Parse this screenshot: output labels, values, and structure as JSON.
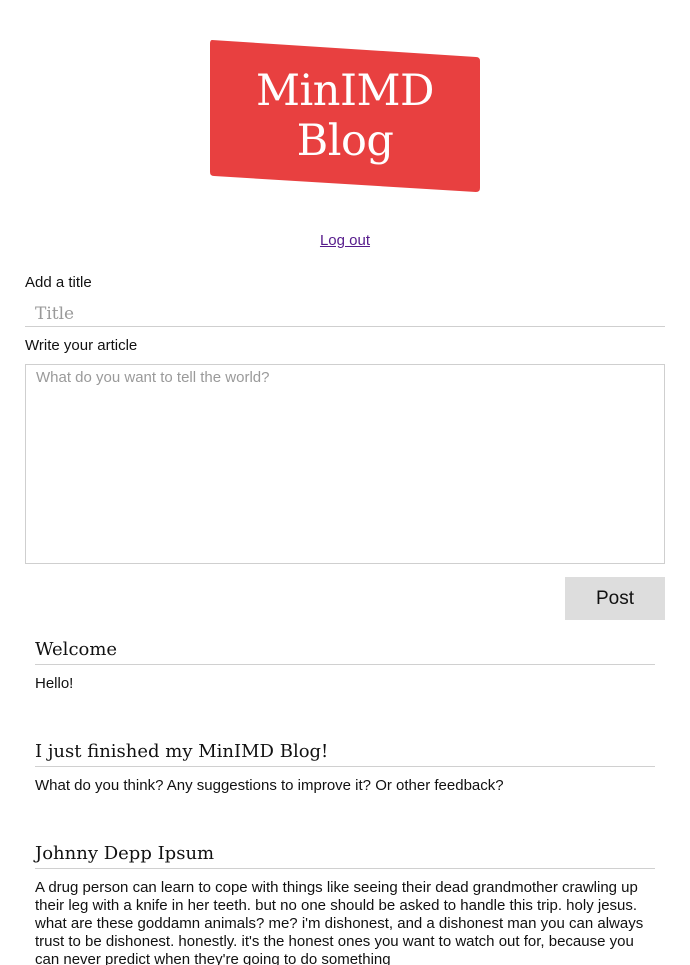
{
  "header": {
    "logo_line1": "MinIMD",
    "logo_line2": "Blog",
    "logo_color": "#e84040",
    "logout_label": "Log out"
  },
  "form": {
    "title_label": "Add a title",
    "title_placeholder": "Title",
    "article_label": "Write your article",
    "article_placeholder": "What do you want to tell the world?",
    "post_label": "Post"
  },
  "posts": [
    {
      "title": "Welcome",
      "body": "Hello!"
    },
    {
      "title": "I just finished my MinIMD Blog!",
      "body": "What do you think? Any suggestions to improve it? Or other feedback?"
    },
    {
      "title": "Johnny Depp Ipsum",
      "body": "A drug person can learn to cope with things like seeing their dead grandmother crawling up their leg with a knife in her teeth. but no one should be asked to handle this trip. holy jesus. what are these goddamn animals? me? i'm dishonest, and a dishonest man you can always trust to be dishonest. honestly. it's the honest ones you want to watch out for, because you can never predict when they're going to do something"
    }
  ]
}
